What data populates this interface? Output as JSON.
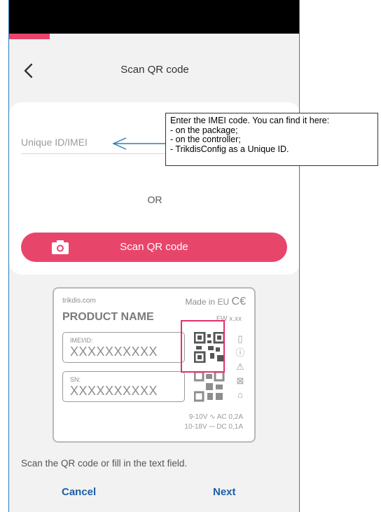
{
  "header": {
    "title": "Scan QR code"
  },
  "form": {
    "imei_placeholder": "Unique ID/IMEI",
    "or_text": "OR",
    "scan_button_label": "Scan QR code"
  },
  "label_illustration": {
    "site": "trikdis.com",
    "product_name": "PRODUCT NAME",
    "made_in": "Made in EU",
    "fw": "FW x.xx",
    "imei_key": "IMEI/ID:",
    "imei_value": "XXXXXXXXXX",
    "sn_key": "SN:",
    "sn_value": "XXXXXXXXXX",
    "power_line1": "9-10V ∿ AC 0,2A",
    "power_line2": "10-18V ⎓ DC 0,1A"
  },
  "hint": "Scan the QR code or fill in the text field.",
  "footer": {
    "cancel_label": "Cancel",
    "next_label": "Next"
  },
  "callout": {
    "lines": [
      "Enter the IMEI code. You can find it here:",
      "- on the package;",
      "- on the controller;",
      "- TrikdisConfig as a Unique ID."
    ]
  },
  "colors": {
    "accent": "#e8456b",
    "link": "#1c5ea8",
    "status_bar": "#000000",
    "callout_border": "#2f7fb3"
  }
}
